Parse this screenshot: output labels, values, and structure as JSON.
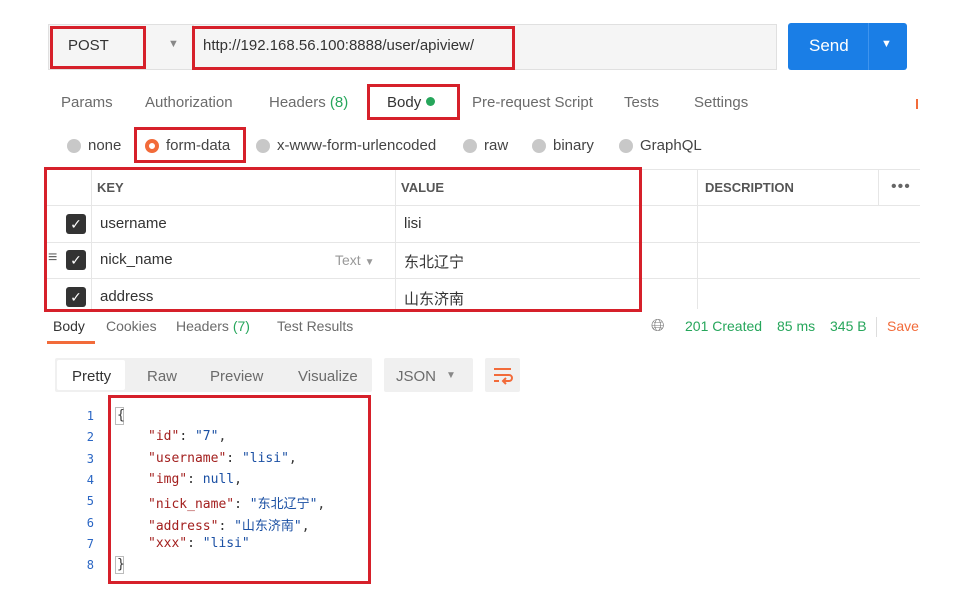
{
  "request": {
    "method": "POST",
    "url": "http://192.168.56.100:8888/user/apiview/",
    "send_label": "Send"
  },
  "request_tabs": [
    {
      "label": "Params"
    },
    {
      "label": "Authorization"
    },
    {
      "label": "Headers",
      "count": "(8)"
    },
    {
      "label": "Body",
      "active": true
    },
    {
      "label": "Pre-request Script"
    },
    {
      "label": "Tests"
    },
    {
      "label": "Settings"
    }
  ],
  "body_types": [
    {
      "label": "none"
    },
    {
      "label": "form-data",
      "selected": true
    },
    {
      "label": "x-www-form-urlencoded"
    },
    {
      "label": "raw"
    },
    {
      "label": "binary"
    },
    {
      "label": "GraphQL"
    }
  ],
  "params_table": {
    "headers": [
      "KEY",
      "VALUE",
      "DESCRIPTION"
    ],
    "rows": [
      {
        "checked": true,
        "key": "username",
        "value": "lisi"
      },
      {
        "checked": true,
        "key": "nick_name",
        "type": "Text",
        "value": "东北辽宁"
      },
      {
        "checked": true,
        "key": "address",
        "value": "山东济南"
      }
    ]
  },
  "response_tabs": [
    {
      "label": "Body",
      "active": true
    },
    {
      "label": "Cookies"
    },
    {
      "label": "Headers",
      "count": "(7)"
    },
    {
      "label": "Test Results"
    }
  ],
  "response_meta": {
    "status": "201 Created",
    "time": "85 ms",
    "size": "345 B",
    "save_label": "Save"
  },
  "response_views": [
    "Pretty",
    "Raw",
    "Preview",
    "Visualize"
  ],
  "response_format": "JSON",
  "response_lines": [
    {
      "n": "1",
      "text": "{"
    },
    {
      "n": "2",
      "key": "\"id\"",
      "val": "\"7\"",
      "comma": ","
    },
    {
      "n": "3",
      "key": "\"username\"",
      "val": "\"lisi\"",
      "comma": ","
    },
    {
      "n": "4",
      "key": "\"img\"",
      "val": "null",
      "comma": ","
    },
    {
      "n": "5",
      "key": "\"nick_name\"",
      "val": "\"东北辽宁\"",
      "comma": ","
    },
    {
      "n": "6",
      "key": "\"address\"",
      "val": "\"山东济南\"",
      "comma": ","
    },
    {
      "n": "7",
      "key": "\"xxx\"",
      "val": "\"lisi\"",
      "comma": ""
    },
    {
      "n": "8",
      "text": "}"
    }
  ],
  "colors": {
    "accent": "#f26b3a",
    "send": "#1a7ee6",
    "success": "#26a65b",
    "highlight": "#d6202a"
  },
  "icons": [
    "chevron-down-icon",
    "checkbox-checked-icon",
    "drag-handle-icon",
    "globe-icon",
    "wrap-lines-icon",
    "more-options-icon"
  ]
}
